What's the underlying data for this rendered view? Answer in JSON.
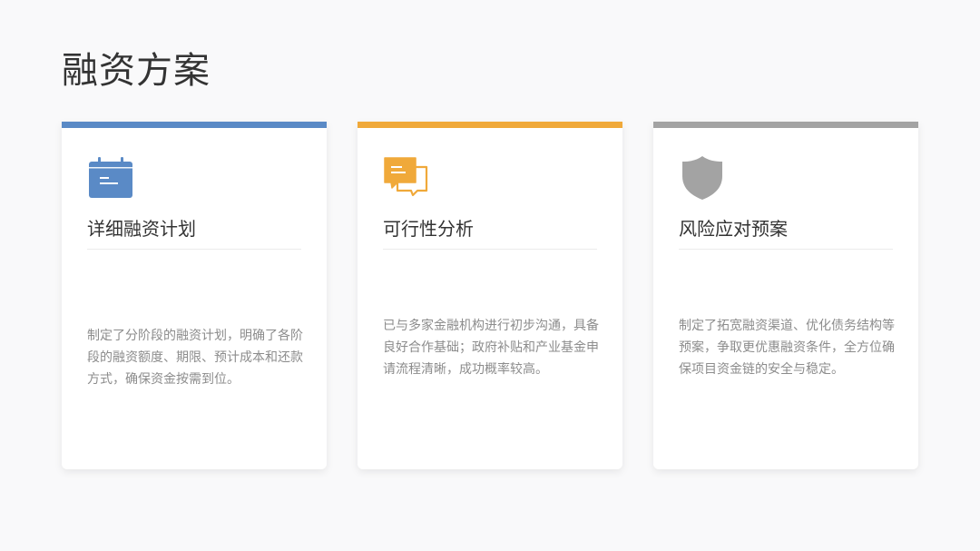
{
  "title": "融资方案",
  "cards": [
    {
      "accent": "#5a8ac6",
      "icon": "calendar-icon",
      "title": "详细融资计划",
      "description": "制定了分阶段的融资计划，明确了各阶段的融资额度、期限、预计成本和还款方式，确保资金按需到位。"
    },
    {
      "accent": "#f0a93a",
      "icon": "chat-bubbles-icon",
      "title": "可行性分析",
      "description": "已与多家金融机构进行初步沟通，具备良好合作基础；政府补贴和产业基金申请流程清晰，成功概率较高。"
    },
    {
      "accent": "#a3a3a3",
      "icon": "shield-icon",
      "title": "风险应对预案",
      "description": "制定了拓宽融资渠道、优化债务结构等预案，争取更优惠融资条件，全方位确保项目资金链的安全与稳定。"
    }
  ]
}
